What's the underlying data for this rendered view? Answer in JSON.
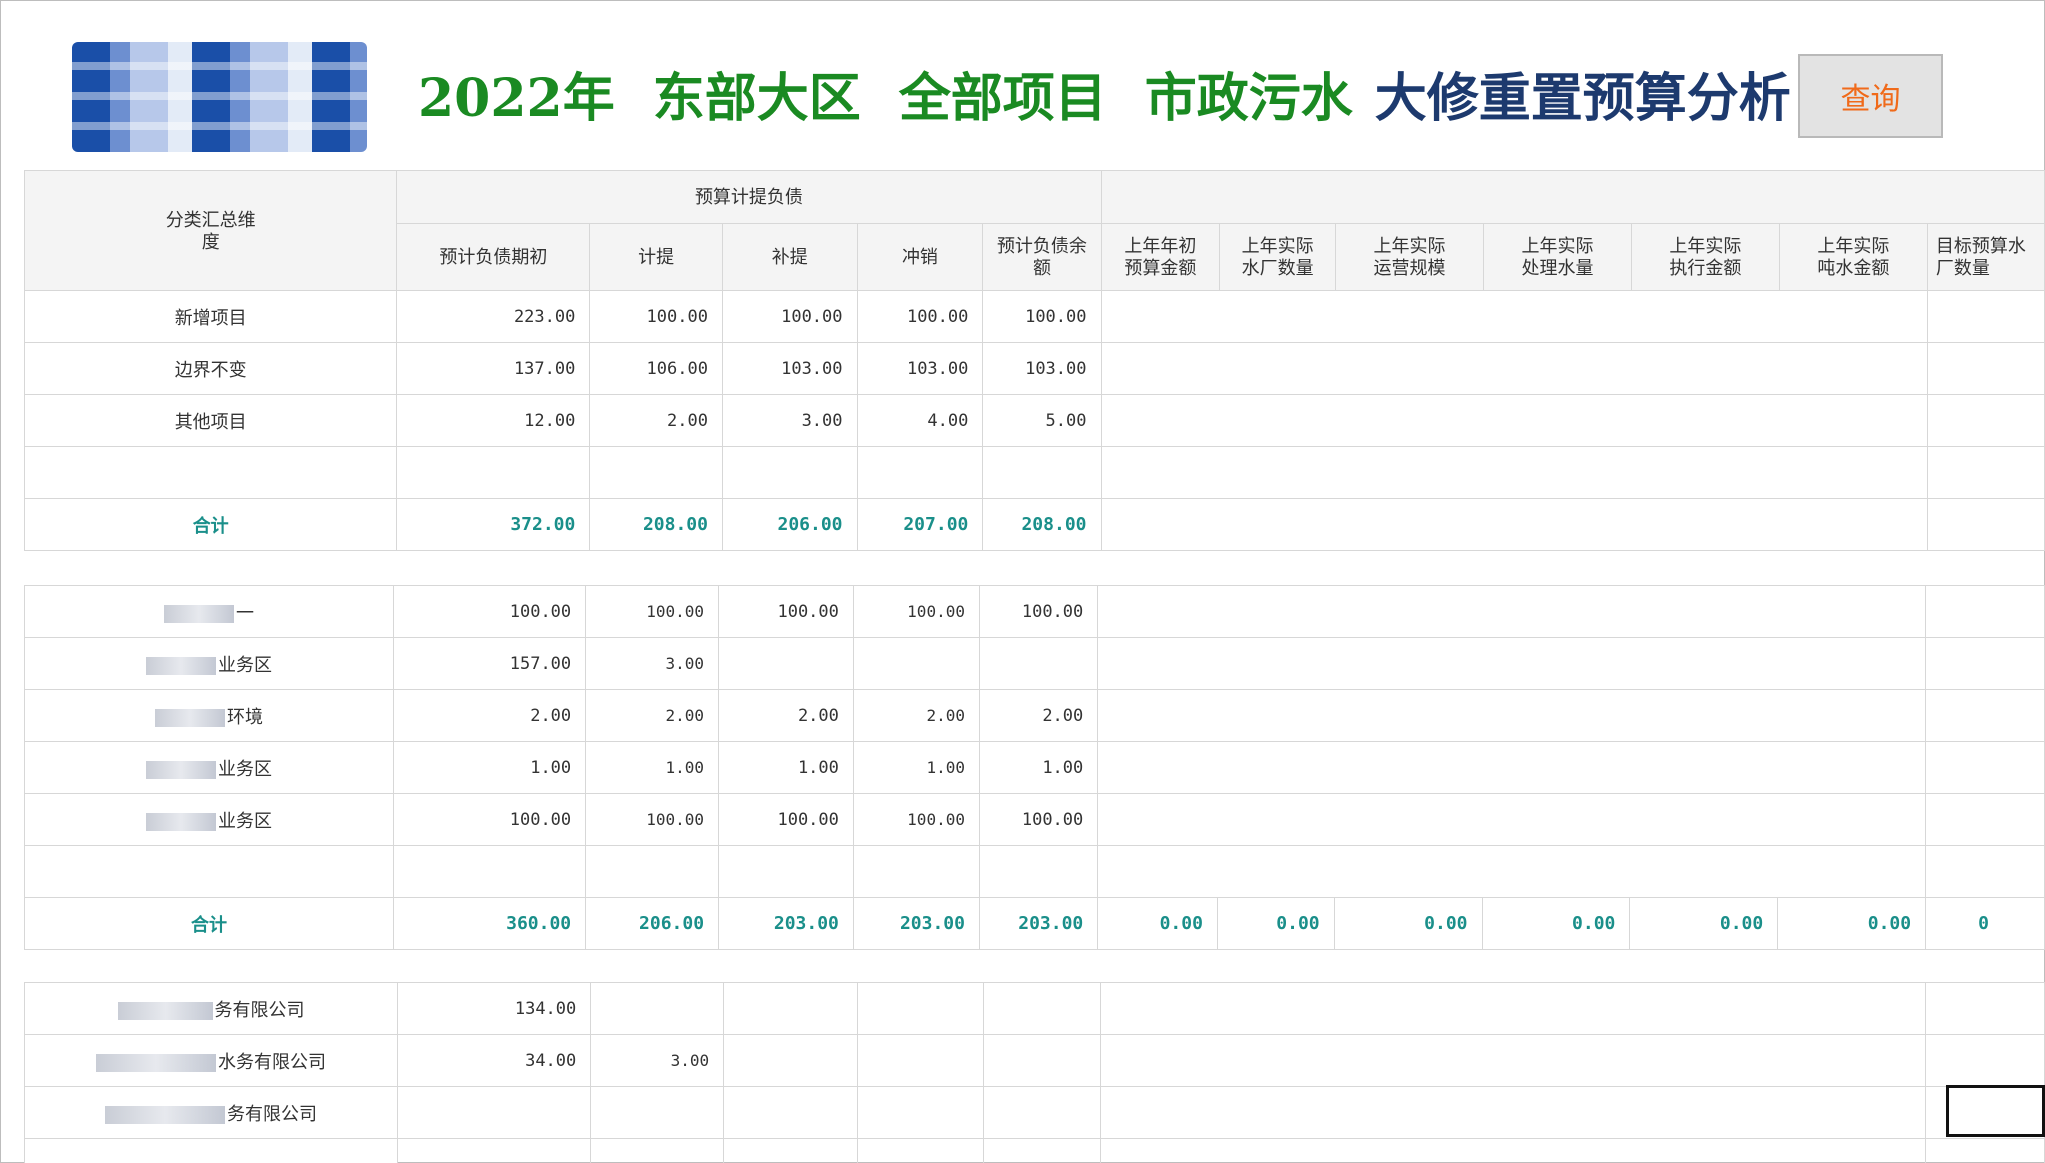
{
  "header": {
    "title_parts": [
      "2022年",
      "东部大区",
      "全部项目",
      "市政污水",
      "大修重置预算分析"
    ],
    "query_button": "查询"
  },
  "table": {
    "dimension_header": "分类汇总维度",
    "group_header": "预算计提负债",
    "columns": [
      "预计负债期初",
      "计提",
      "补提",
      "冲销",
      "预计负债余额"
    ],
    "extra_columns": [
      "上年年初预算金额",
      "上年实际水厂数量",
      "上年实际运营规模",
      "上年实际处理水量",
      "上年实际执行金额",
      "上年实际吨水金额",
      "目标预算水厂数量"
    ],
    "section1": {
      "rows": [
        {
          "label": "新增项目",
          "values": [
            "223.00",
            "100.00",
            "100.00",
            "100.00",
            "100.00"
          ]
        },
        {
          "label": "边界不变",
          "values": [
            "137.00",
            "106.00",
            "103.00",
            "103.00",
            "103.00"
          ]
        },
        {
          "label": "其他项目",
          "values": [
            "12.00",
            "2.00",
            "3.00",
            "4.00",
            "5.00"
          ]
        }
      ],
      "total": {
        "label": "合计",
        "values": [
          "372.00",
          "208.00",
          "206.00",
          "207.00",
          "208.00"
        ]
      }
    },
    "section2": {
      "rows": [
        {
          "label": "一",
          "values": [
            "100.00",
            "100.00",
            "100.00",
            "100.00",
            "100.00"
          ]
        },
        {
          "label": "业务区",
          "values": [
            "157.00",
            "3.00",
            "",
            "",
            ""
          ]
        },
        {
          "label": "环境",
          "values": [
            "2.00",
            "2.00",
            "2.00",
            "2.00",
            "2.00"
          ]
        },
        {
          "label": "业务区",
          "values": [
            "1.00",
            "1.00",
            "1.00",
            "1.00",
            "1.00"
          ]
        },
        {
          "label": "业务区",
          "values": [
            "100.00",
            "100.00",
            "100.00",
            "100.00",
            "100.00"
          ]
        }
      ],
      "total": {
        "label": "合计",
        "values": [
          "360.00",
          "206.00",
          "203.00",
          "203.00",
          "203.00"
        ]
      },
      "extra_totals": [
        "0.00",
        "0.00",
        "0.00",
        "0.00",
        "0.00",
        "0.00",
        "0"
      ]
    },
    "section3": {
      "rows": [
        {
          "label": "务有限公司",
          "values": [
            "134.00",
            "",
            "",
            "",
            ""
          ]
        },
        {
          "label": "水务有限公司",
          "values": [
            "34.00",
            "3.00",
            "",
            "",
            ""
          ]
        },
        {
          "label": "务有限公司",
          "values": [
            "",
            "",
            "",
            "",
            ""
          ]
        }
      ]
    }
  },
  "colors": {
    "title_green": "#1a8a22",
    "title_navy": "#1d3a6e",
    "total_teal": "#1a8f8a",
    "query_text": "#f06a1a"
  }
}
